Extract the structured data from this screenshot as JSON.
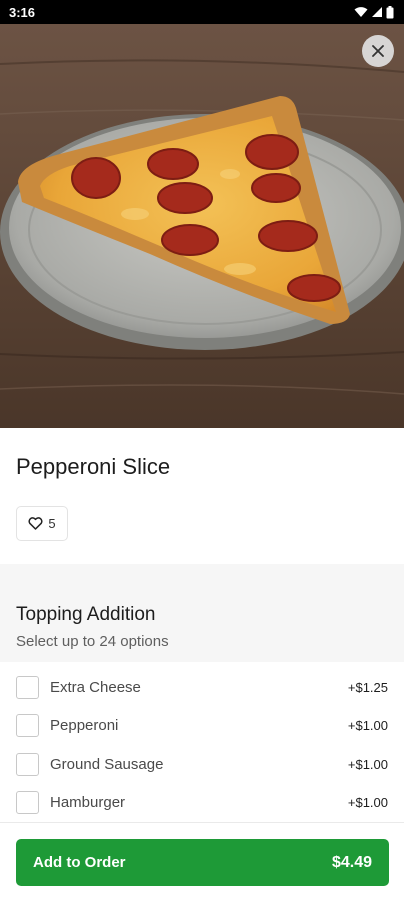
{
  "status_bar": {
    "time": "3:16"
  },
  "hero": {
    "image_icon": "pizza-slice-photo"
  },
  "item": {
    "title": "Pepperoni Slice",
    "likes": "5"
  },
  "topping_section": {
    "title": "Topping Addition",
    "subtitle": "Select up to 24 options",
    "options": [
      {
        "label": "Extra Cheese",
        "price": "+$1.25",
        "checked": false
      },
      {
        "label": "Pepperoni",
        "price": "+$1.00",
        "checked": false
      },
      {
        "label": "Ground Sausage",
        "price": "+$1.00",
        "checked": false
      },
      {
        "label": "Hamburger",
        "price": "+$1.00",
        "checked": false
      }
    ]
  },
  "footer": {
    "button_label": "Add to Order",
    "button_price": "$4.49"
  },
  "colors": {
    "accent": "#1e9a37",
    "status_bar": "#000000"
  }
}
